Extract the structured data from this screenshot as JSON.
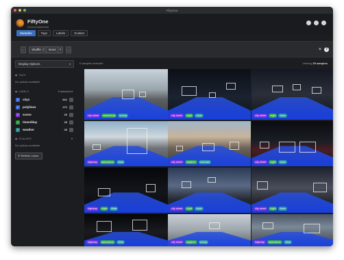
{
  "window_title": "FiftyOne",
  "app": {
    "name": "FiftyOne",
    "subtitle": "20201008092509"
  },
  "tabs": [
    {
      "label": "Samples",
      "active": true
    },
    {
      "label": "Tags",
      "active": false
    },
    {
      "label": "Labels",
      "active": false
    },
    {
      "label": "Scalars",
      "active": false
    }
  ],
  "filterbar": {
    "chip_shuffle": "Shuffle",
    "chip_none": "None"
  },
  "sidebar": {
    "display_options": "Display Options",
    "tags": {
      "header": "TAGS",
      "empty": "No options available"
    },
    "labels": {
      "header": "LABELS",
      "selector": "5 selected",
      "items": [
        {
          "name": "cityscapes",
          "display": "cityx",
          "count": "601",
          "color": "#3a66d6"
        },
        {
          "name": "polylines",
          "display": "polylines",
          "count": "272",
          "color": "#3a66d6"
        },
        {
          "name": "scene",
          "display": "scene",
          "count": "25",
          "color": "#7a3ad6"
        },
        {
          "name": "timeofday",
          "display": "timeofday",
          "count": "25",
          "color": "#2a9a3a"
        },
        {
          "name": "weather",
          "display": "weather",
          "count": "25",
          "color": "#2a8a8a"
        }
      ]
    },
    "scalars": {
      "header": "SCALARS",
      "empty": "No options available"
    },
    "refresh": "Refresh colors"
  },
  "selection": {
    "selected": "0 samples selected",
    "viewing_prefix": "Viewing",
    "viewing_count": "25 samples"
  },
  "tile_tags": [
    [
      "city street",
      "dawn/dusk",
      "snowy"
    ],
    [
      "city street",
      "night",
      "clear"
    ],
    [
      "city street",
      "night",
      "clear"
    ],
    [
      "highway",
      "dawn/dusk",
      "clear"
    ],
    [
      "city street",
      "daytime",
      "overcast"
    ],
    [
      "city street",
      "night",
      "clear"
    ],
    [
      "highway",
      "night",
      "clear"
    ],
    [
      "city street",
      "night",
      "clear"
    ],
    [
      "city street",
      "night",
      "clear"
    ],
    [
      "highway",
      "dawn/dusk",
      "clear"
    ],
    [
      "city street",
      "daytime",
      "snowy"
    ],
    [
      "highway",
      "dawn/dusk",
      "clear"
    ]
  ],
  "tag_colors": {
    "scene": "#7a30e0",
    "timeofday": "#2fa84a",
    "weather": "#2a9aa0"
  }
}
